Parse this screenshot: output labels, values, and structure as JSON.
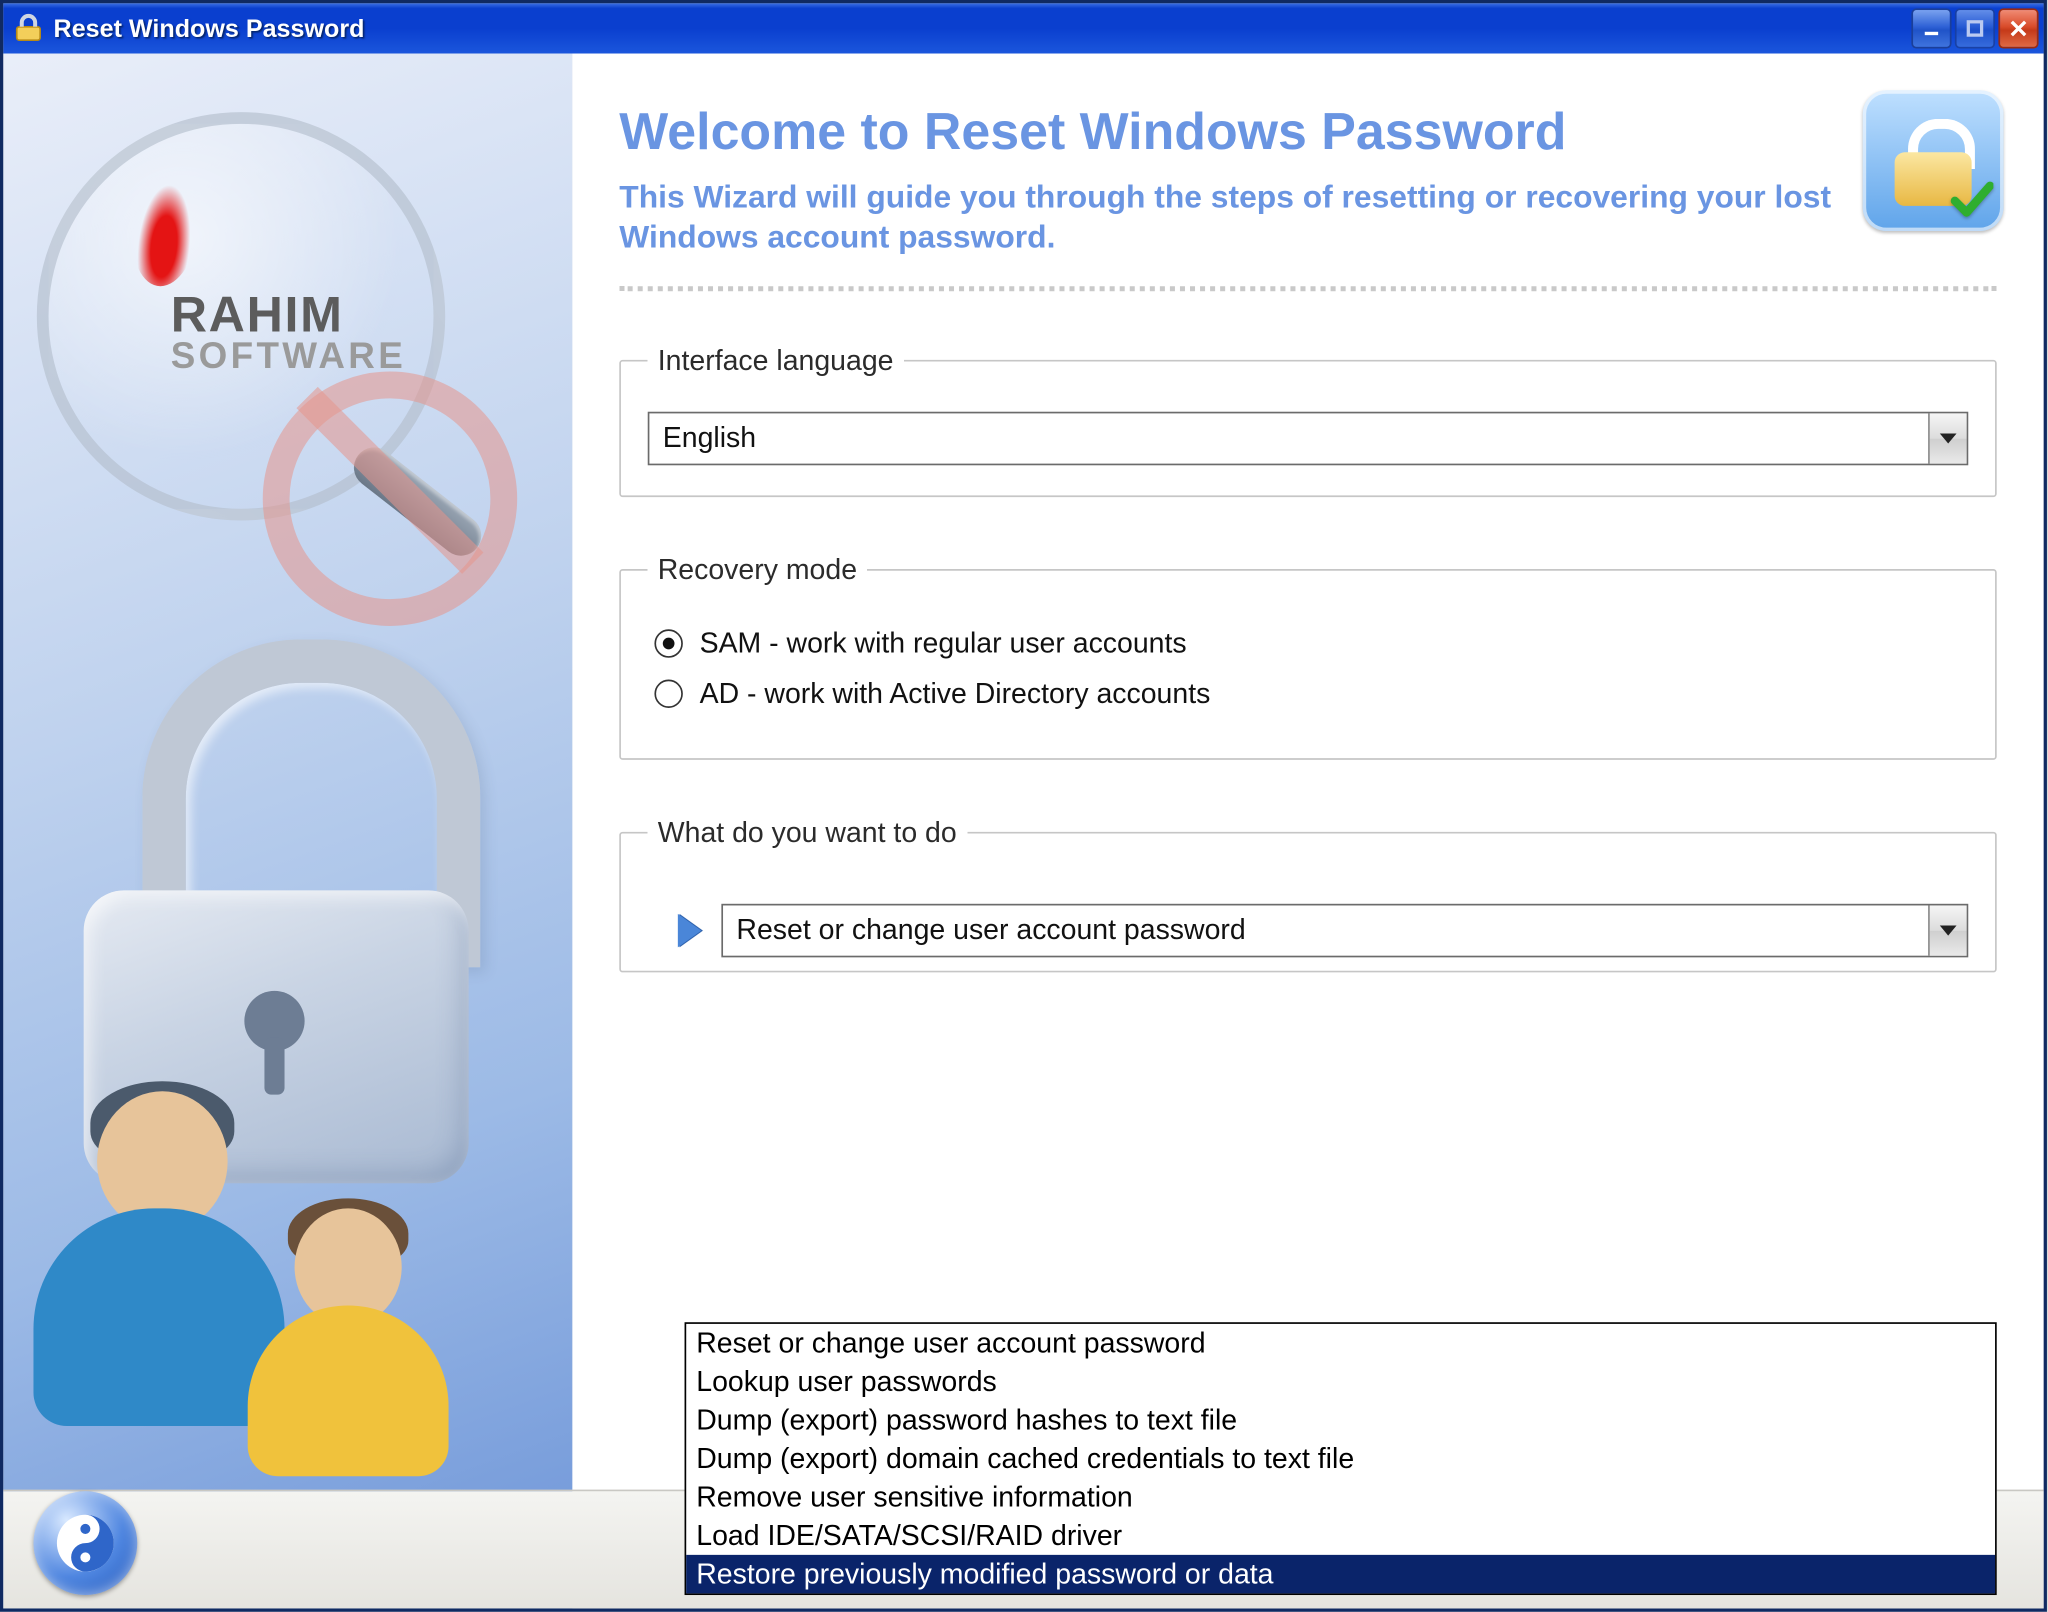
{
  "titlebar": {
    "title": "Reset Windows Password"
  },
  "left_brand": {
    "line1": "RAHIM",
    "line2": "SOFTWARE"
  },
  "header": {
    "heading": "Welcome to Reset Windows Password",
    "subheading": "This Wizard will guide you through the steps of resetting or recovering your lost Windows account password."
  },
  "language_group": {
    "legend": "Interface language",
    "value": "English"
  },
  "recovery_group": {
    "legend": "Recovery mode",
    "option_sam": "SAM - work with regular user accounts",
    "option_ad": "AD - work with Active Directory accounts",
    "selected": "sam"
  },
  "action_group": {
    "legend": "What do you want to do",
    "value": "Reset or change user account password",
    "options": [
      "Reset or change user account password",
      "Lookup user passwords",
      "Dump (export) password hashes to text file",
      "Dump (export) domain cached credentials to text file",
      "Remove user sensitive information",
      "Load IDE/SATA/SCSI/RAID driver",
      "Restore previously modified password or data"
    ],
    "highlighted_index": 6
  }
}
